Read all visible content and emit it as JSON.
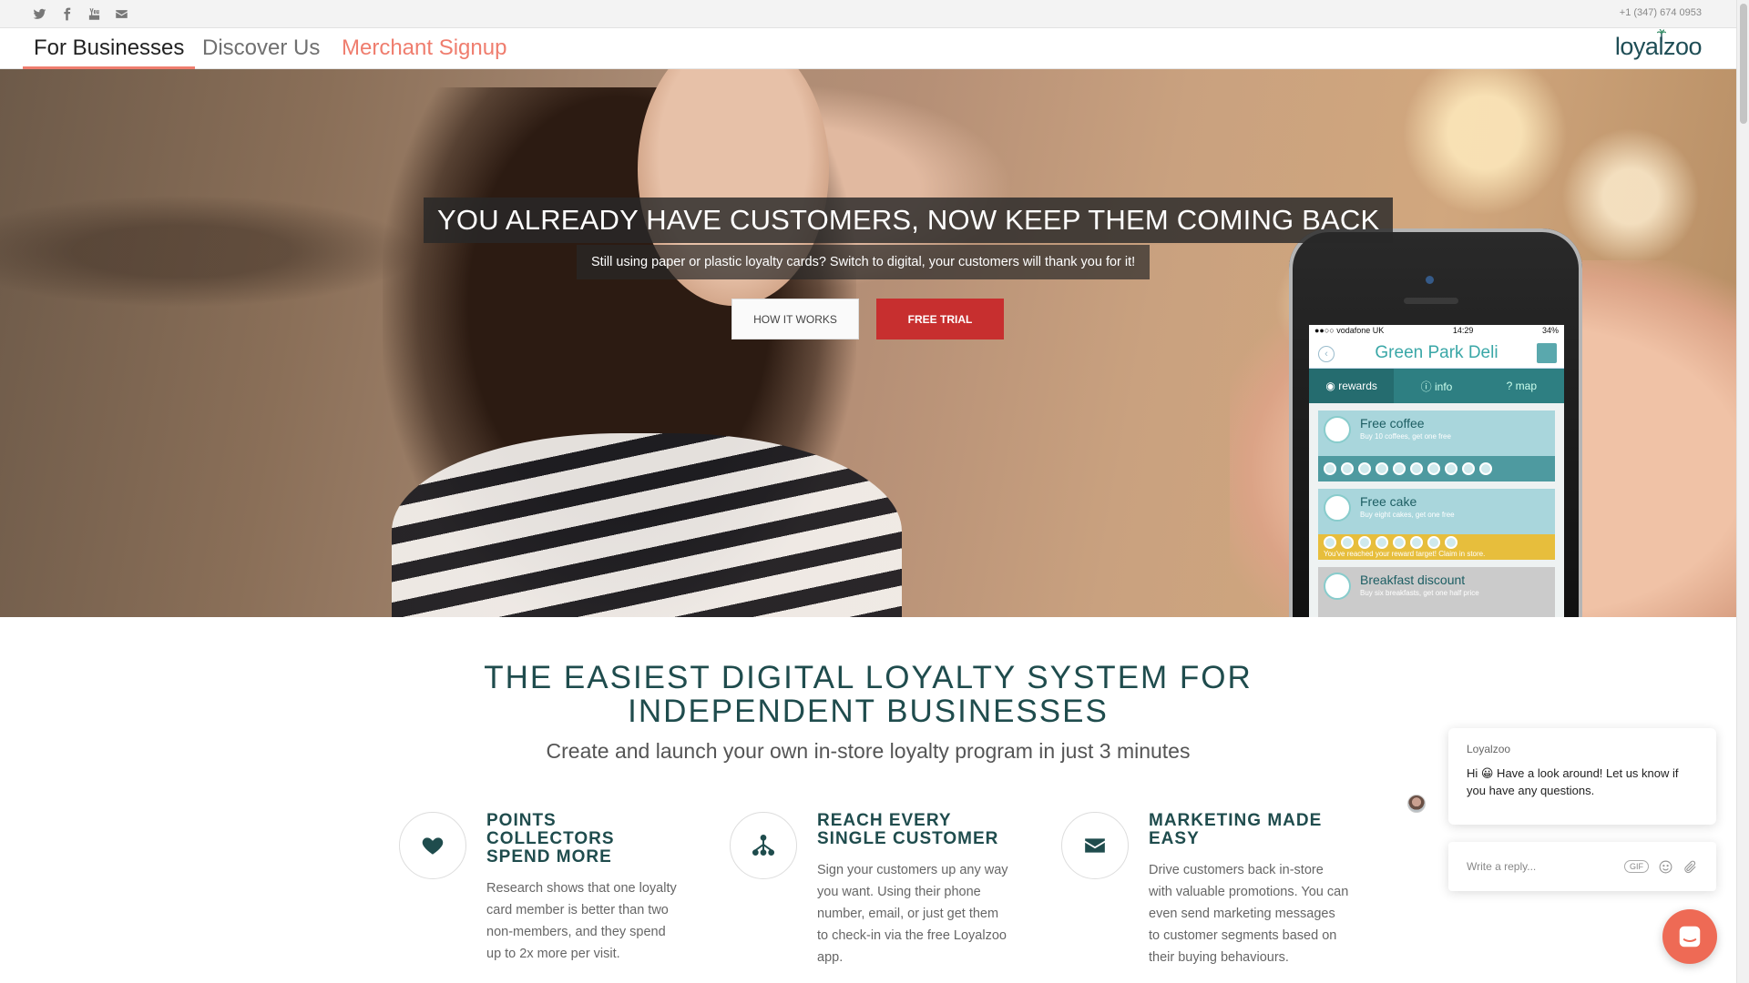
{
  "topbar": {
    "social": [
      "twitter-icon",
      "facebook-icon",
      "youtube-icon",
      "mail-icon"
    ],
    "phone": "+1 (347) 674 0953"
  },
  "nav": {
    "items": [
      {
        "label": "For Businesses",
        "active": true
      },
      {
        "label": "Discover Us",
        "active": false
      },
      {
        "label": "Merchant Signup",
        "active": false
      }
    ],
    "logo_a": "loyal",
    "logo_b": "zoo"
  },
  "hero": {
    "title": "YOU ALREADY HAVE CUSTOMERS, NOW KEEP THEM COMING BACK",
    "subtitle": "Still using paper or plastic loyalty cards? Switch to digital, your customers will thank you for it!",
    "btn_how": "HOW IT WORKS",
    "btn_trial": "FREE TRIAL",
    "phone_screen": {
      "carrier": "●●○○ vodafone UK",
      "time": "14:29",
      "battery": "34%",
      "title": "Green Park Deli",
      "tabs": [
        "rewards",
        "info",
        "map"
      ],
      "rewards": [
        {
          "title": "Free coffee",
          "sub": "Buy 10 coffees, get one free"
        },
        {
          "title": "Free cake",
          "sub": "Buy eight cakes, get one free",
          "note": "You've reached your reward target! Claim in store."
        },
        {
          "title": "Breakfast discount",
          "sub": "Buy six breakfasts, get one half price"
        }
      ]
    }
  },
  "main": {
    "title_line1": "THE EASIEST DIGITAL LOYALTY SYSTEM FOR",
    "title_line2": "INDEPENDENT BUSINESSES",
    "subtitle": "Create and launch your own in-store loyalty program in just 3 minutes",
    "features": [
      {
        "icon": "heart-icon",
        "title": "POINTS COLLECTORS SPEND MORE",
        "body": "Research shows that one loyalty card member is better than two non-members, and they spend up to 2x more per visit."
      },
      {
        "icon": "network-icon",
        "title": "REACH EVERY SINGLE CUSTOMER",
        "body": "Sign your customers up any way you want. Using their phone number, email, or just get them to check-in via the free Loyalzoo app."
      },
      {
        "icon": "envelope-icon",
        "title": "MARKETING MADE EASY",
        "body": "Drive customers back in-store with valuable promotions. You can even send marketing messages to customer segments based on their buying behaviours."
      }
    ]
  },
  "chat": {
    "from": "Loyalzoo",
    "message": "Hi 😀 Have a look around! Let us know if you have any questions.",
    "reply_placeholder": "Write a reply...",
    "gif_label": "GIF"
  }
}
